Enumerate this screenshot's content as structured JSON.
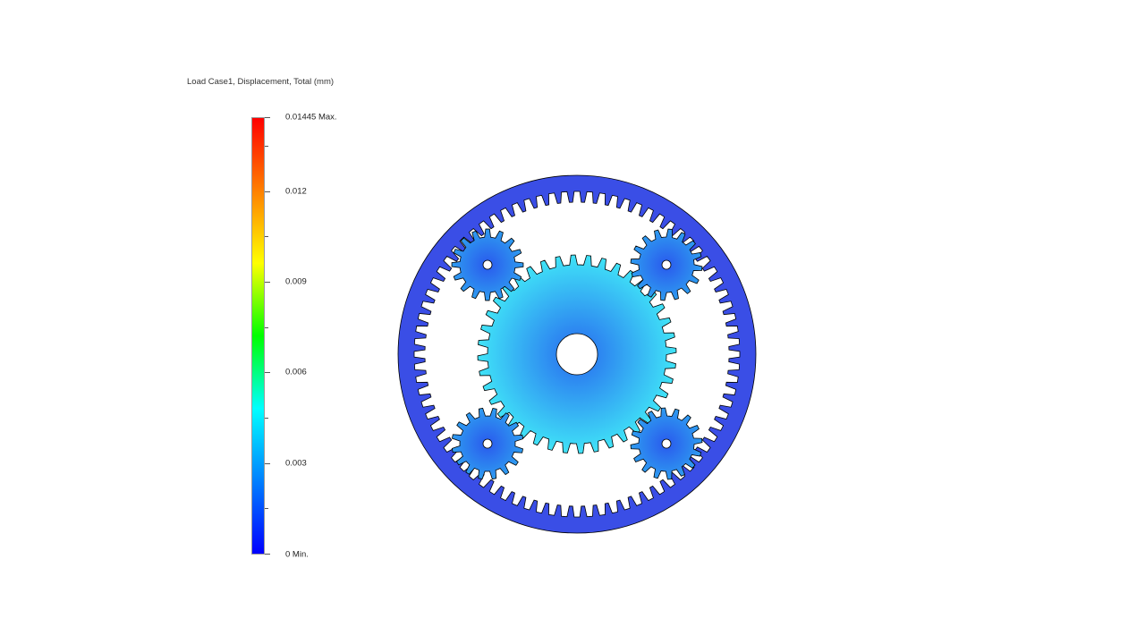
{
  "legend": {
    "title": "Load Case1, Displacement, Total (mm)",
    "max_label": "0.01445 Max.",
    "min_label": "0 Min.",
    "tick_labels": [
      "0.012",
      "0.009",
      "0.006",
      "0.003"
    ],
    "min_value": 0,
    "max_value": 0.01445,
    "tick_values": [
      0.012,
      0.009,
      0.006,
      0.003
    ],
    "colormap": [
      "#0000ff",
      "#0080ff",
      "#00ffff",
      "#00ff00",
      "#ffff00",
      "#ff8000",
      "#ff0000"
    ]
  },
  "colors": {
    "ring_gear": "#3a4ee6",
    "planet_gear": "#2e9bf0",
    "sun_gear_center": "#2b7df0",
    "sun_gear_edge": "#40e3f7",
    "outline": "#000000",
    "background": "#ffffff"
  },
  "model": {
    "ring_teeth": 80,
    "sun_teeth": 40,
    "planet_teeth": 16,
    "planet_count": 4
  }
}
